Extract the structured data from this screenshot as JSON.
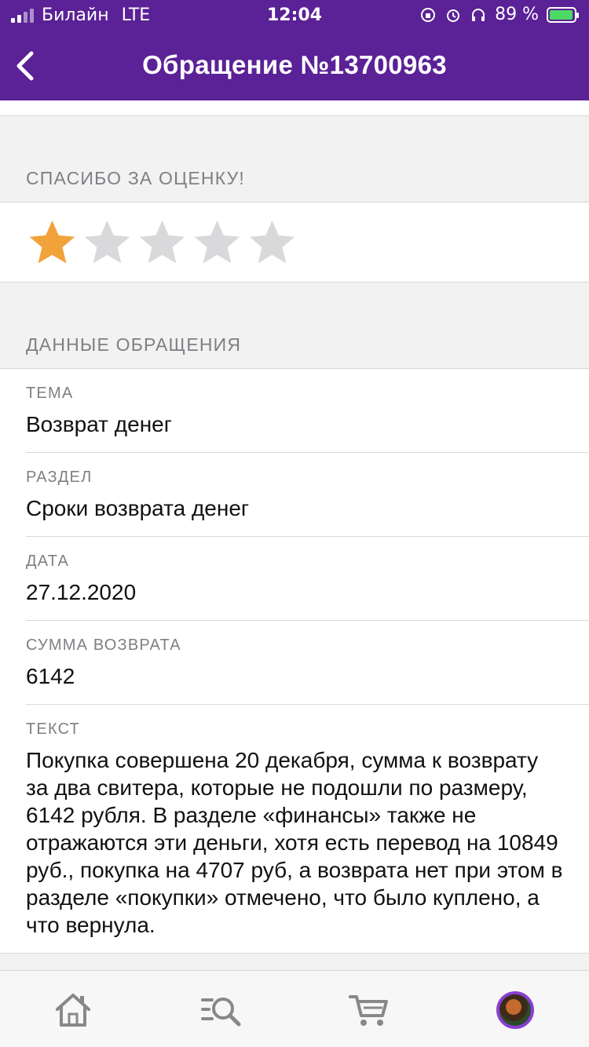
{
  "status_bar": {
    "carrier": "Билайн",
    "network": "LTE",
    "time": "12:04",
    "battery_percent": "89 %"
  },
  "nav": {
    "title": "Обращение №13700963"
  },
  "rating": {
    "header": "СПАСИБО ЗА ОЦЕНКУ!",
    "value": 1,
    "max": 5,
    "active_color": "#f2a23a",
    "inactive_color": "#d9d9db"
  },
  "details": {
    "header": "ДАННЫЕ ОБРАЩЕНИЯ",
    "topic_label": "ТЕМА",
    "topic_value": "Возврат денег",
    "section_label": "РАЗДЕЛ",
    "section_value": "Сроки возврата денег",
    "date_label": "ДАТА",
    "date_value": "27.12.2020",
    "amount_label": "СУММА ВОЗВРАТА",
    "amount_value": "6142",
    "text_label": "ТЕКСТ",
    "text_value": "Покупка совершена 20 декабря, сумма к возврату за два свитера, которые не подошли по размеру, 6142 рубля. В разделе «финансы» также не отражаются эти деньги, хотя есть перевод на 10849 руб., покупка на 4707 руб, а возврата нет при этом в разделе «покупки» отмечено,  что было куплено, а что вернула."
  },
  "tabbar": {
    "items": [
      "home-icon",
      "search-catalog-icon",
      "cart-icon",
      "profile-avatar"
    ]
  },
  "colors": {
    "brand": "#5b2196",
    "accent": "#8a3fd1"
  }
}
